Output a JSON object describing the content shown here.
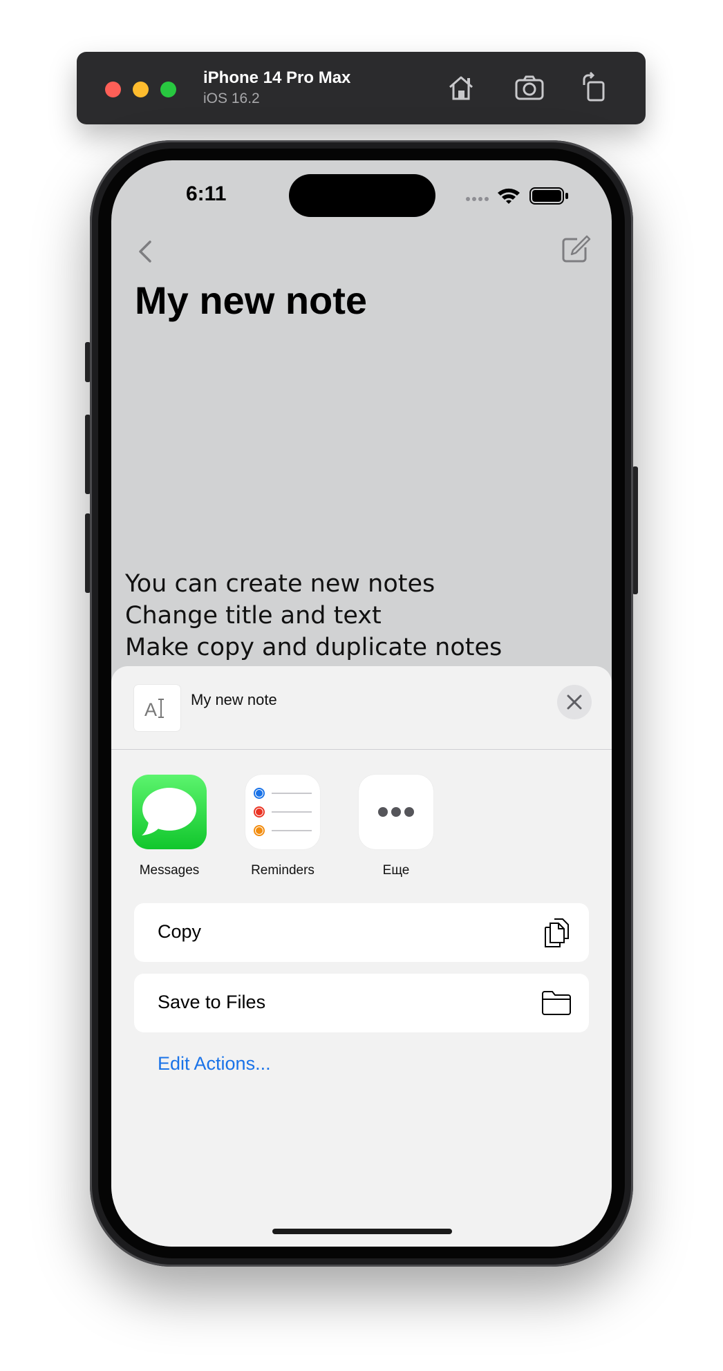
{
  "simulator": {
    "device_name": "iPhone 14 Pro Max",
    "os_version": "iOS 16.2",
    "buttons": [
      "home-icon",
      "screenshot-icon",
      "rotate-icon"
    ]
  },
  "status_bar": {
    "time": "6:11",
    "icons": [
      "cellular-icon",
      "wifi-icon",
      "battery-icon"
    ]
  },
  "note": {
    "title": "My new note",
    "lines": [
      "You can create new notes",
      "Change title and text",
      "Make copy and duplicate notes"
    ]
  },
  "share_sheet": {
    "item_title": "My new note",
    "apps": [
      {
        "label": "Messages",
        "icon": "messages-icon"
      },
      {
        "label": "Reminders",
        "icon": "reminders-icon"
      },
      {
        "label": "Еще",
        "icon": "more-icon"
      }
    ],
    "actions": [
      {
        "label": "Copy",
        "icon": "copy-icon"
      },
      {
        "label": "Save to Files",
        "icon": "folder-icon"
      }
    ],
    "edit_actions_label": "Edit Actions..."
  },
  "colors": {
    "accent": "#1a73e8",
    "messages_green": "#25d23e",
    "reminder_blue": "#1a73e8",
    "reminder_red": "#ea3323",
    "reminder_orange": "#f28c0e"
  }
}
